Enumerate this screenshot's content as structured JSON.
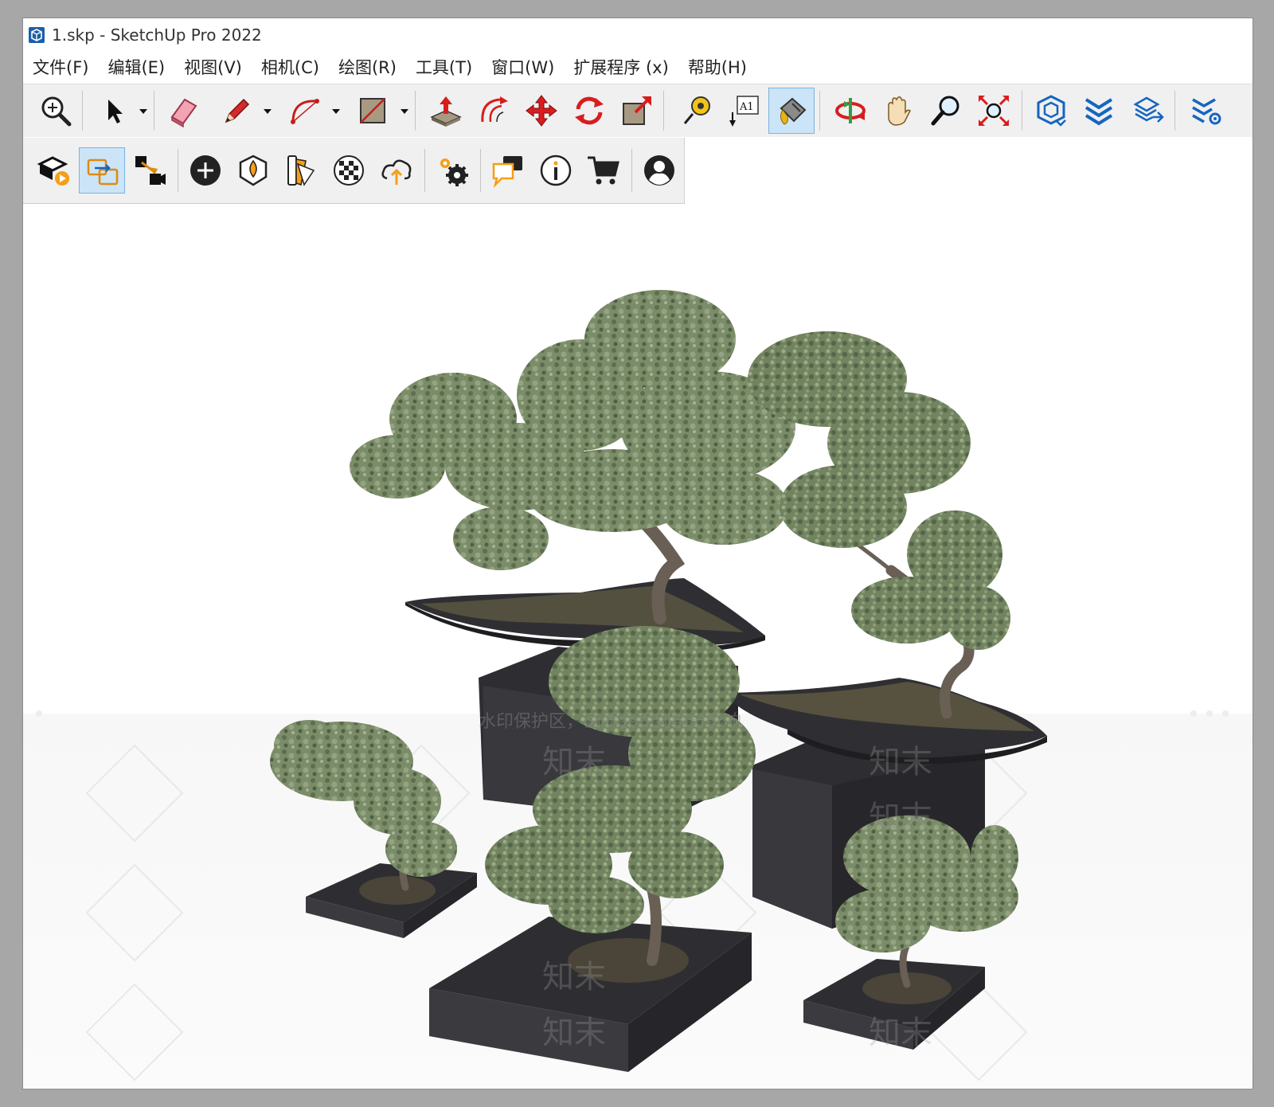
{
  "window": {
    "title": "1.skp - SketchUp Pro 2022"
  },
  "menu": [
    {
      "label": "文件(F)"
    },
    {
      "label": "编辑(E)"
    },
    {
      "label": "视图(V)"
    },
    {
      "label": "相机(C)"
    },
    {
      "label": "绘图(R)"
    },
    {
      "label": "工具(T)"
    },
    {
      "label": "窗口(W)"
    },
    {
      "label": "扩展程序 (x)"
    },
    {
      "label": "帮助(H)"
    }
  ],
  "toolbar_primary": [
    {
      "icon": "zoom-extents-icon"
    },
    {
      "icon": "select-icon",
      "has_dropdown": true
    },
    {
      "icon": "eraser-icon"
    },
    {
      "icon": "pencil-line-icon",
      "has_dropdown": true
    },
    {
      "icon": "arc-icon",
      "has_dropdown": true
    },
    {
      "icon": "rectangle-icon",
      "has_dropdown": true
    },
    {
      "icon": "push-pull-icon"
    },
    {
      "icon": "offset-icon"
    },
    {
      "icon": "move-icon"
    },
    {
      "icon": "rotate-icon"
    },
    {
      "icon": "scale-icon"
    },
    {
      "icon": "tape-measure-icon"
    },
    {
      "icon": "text-icon",
      "text": "A1"
    },
    {
      "icon": "paint-bucket-icon",
      "active": true
    },
    {
      "icon": "orbit-icon"
    },
    {
      "icon": "pan-icon"
    },
    {
      "icon": "zoom-icon"
    },
    {
      "icon": "zoom-window-icon"
    },
    {
      "icon": "3d-warehouse-icon"
    },
    {
      "icon": "extension-warehouse-icon"
    },
    {
      "icon": "layout-send-icon"
    },
    {
      "icon": "extension-manager-icon"
    }
  ],
  "toolbar_secondary": [
    {
      "icon": "trimble-connect-icon"
    },
    {
      "icon": "section-swap-icon",
      "active": true
    },
    {
      "icon": "scenes-icon"
    },
    {
      "icon": "add-location-icon"
    },
    {
      "icon": "model-info-icon"
    },
    {
      "icon": "styles-icon"
    },
    {
      "icon": "materials-checker-icon"
    },
    {
      "icon": "cloud-upload-icon"
    },
    {
      "icon": "preferences-icon"
    },
    {
      "icon": "chat-icon"
    },
    {
      "icon": "info-icon"
    },
    {
      "icon": "cart-icon"
    },
    {
      "icon": "account-icon"
    }
  ],
  "viewport": {
    "watermark_notice": "水印保护区，画质会受到部分影响",
    "watermark_text": "知末"
  },
  "colors": {
    "foliage": "#7b8c68",
    "foliage_dark": "#55654a",
    "planter": "#2f2f33",
    "planter_side": "#3f3f44",
    "trunk": "#6a5f55"
  }
}
